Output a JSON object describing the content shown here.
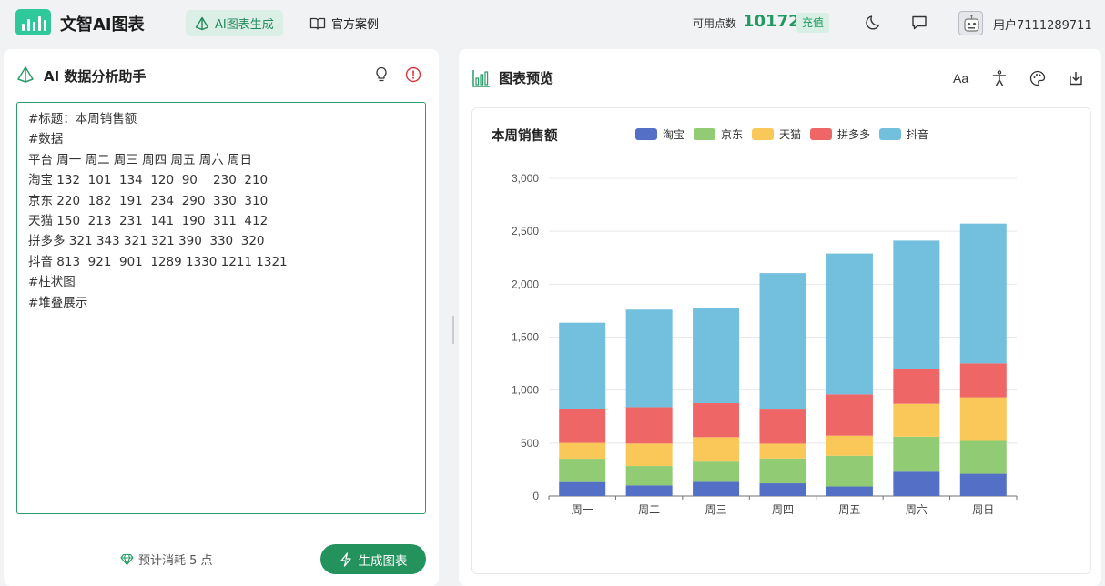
{
  "header": {
    "app_title": "文智AI图表",
    "tab_generate": "AI图表生成",
    "tab_cases": "官方案例",
    "points_label": "可用点数",
    "points_value": "10172",
    "recharge_label": "充值",
    "username": "用户7111289711"
  },
  "left_panel": {
    "title": "AI 数据分析助手",
    "prompt_lines": [
      "#标题：本周销售额",
      "#数据",
      "平台 周一 周二 周三 周四 周五 周六 周日",
      "淘宝 132  101  134  120  90    230  210",
      "京东 220  182  191  234  290  330  310",
      "天猫 150  213  231  141  190  311  412",
      "拼多多 321 343 321 321 390  330  320",
      "抖音 813  921  901  1289 1330 1211 1321",
      "#柱状图",
      "#堆叠展示"
    ],
    "cost_text": "预计消耗 5 点",
    "generate_label": "生成图表"
  },
  "right_panel": {
    "title": "图表预览"
  },
  "colors": {
    "accent": "#23925d",
    "series": [
      "#5470c6",
      "#91cc75",
      "#fac858",
      "#ee6666",
      "#73c0de"
    ]
  },
  "chart_data": {
    "type": "bar",
    "stacked": true,
    "title": "本周销售额",
    "categories": [
      "周一",
      "周二",
      "周三",
      "周四",
      "周五",
      "周六",
      "周日"
    ],
    "series": [
      {
        "name": "淘宝",
        "values": [
          132,
          101,
          134,
          120,
          90,
          230,
          210
        ]
      },
      {
        "name": "京东",
        "values": [
          220,
          182,
          191,
          234,
          290,
          330,
          310
        ]
      },
      {
        "name": "天猫",
        "values": [
          150,
          213,
          231,
          141,
          190,
          311,
          412
        ]
      },
      {
        "name": "拼多多",
        "values": [
          321,
          343,
          321,
          321,
          390,
          330,
          320
        ]
      },
      {
        "name": "抖音",
        "values": [
          813,
          921,
          901,
          1289,
          1330,
          1211,
          1321
        ]
      }
    ],
    "y_ticks": [
      "0",
      "500",
      "1,000",
      "1,500",
      "2,000",
      "2,500",
      "3,000"
    ],
    "ylim": [
      0,
      3000
    ],
    "grid": true,
    "legend_position": "top"
  }
}
